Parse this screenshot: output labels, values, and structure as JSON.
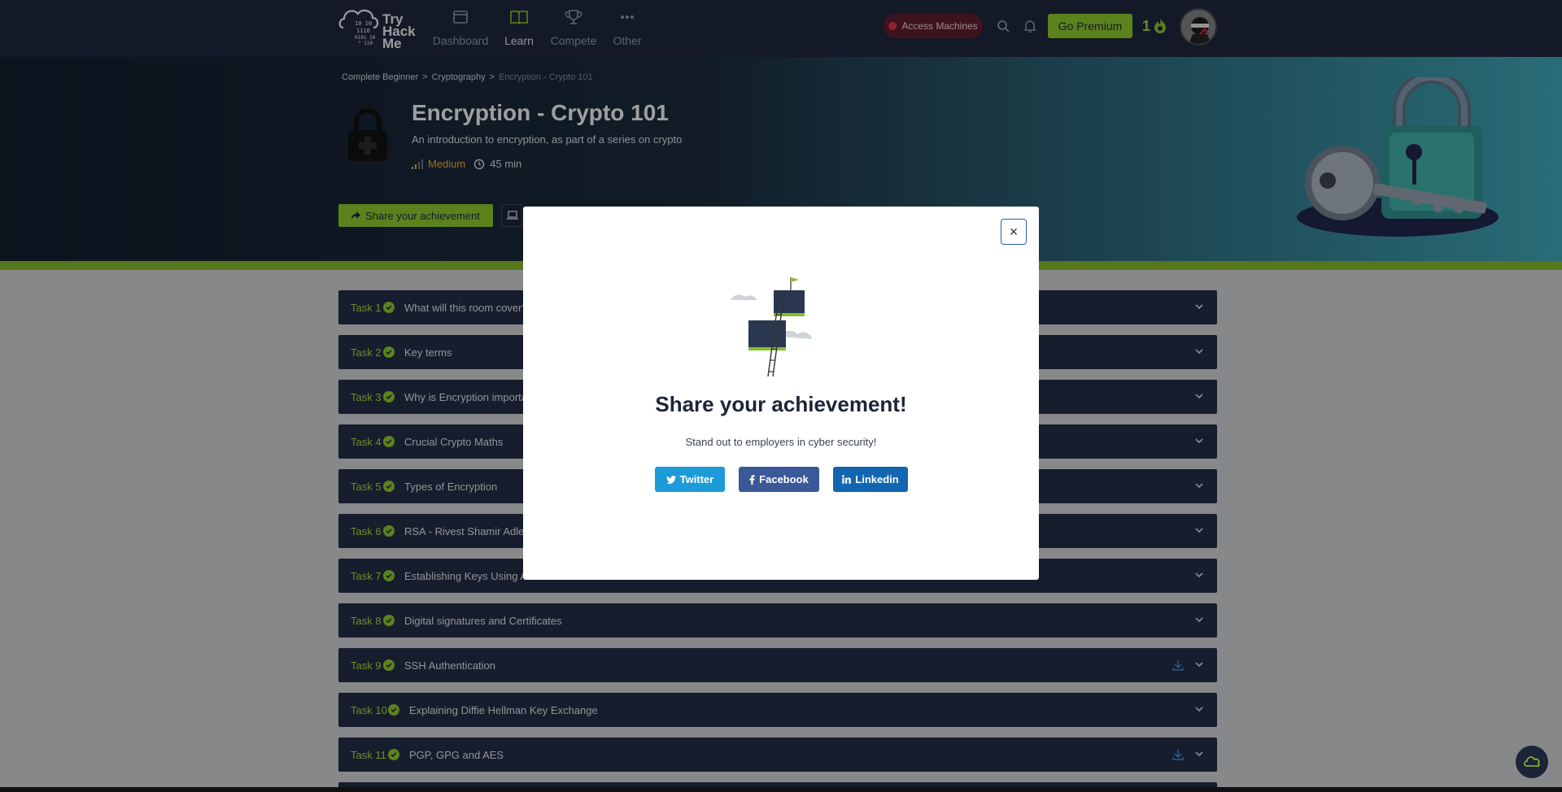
{
  "nav": {
    "brand": "Try Hack Me",
    "items": [
      {
        "label": "Dashboard",
        "icon": "dashboard-icon"
      },
      {
        "label": "Learn",
        "icon": "book-icon",
        "active": true
      },
      {
        "label": "Compete",
        "icon": "trophy-icon"
      },
      {
        "label": "Other",
        "icon": "more-icon"
      }
    ],
    "access_machines": "Access Machines",
    "go_premium": "Go Premium",
    "streak": "1"
  },
  "breadcrumb": {
    "items": [
      "Complete Beginner",
      "Cryptography"
    ],
    "separator": ">",
    "current": "Encryption - Crypto 101"
  },
  "room": {
    "title": "Encryption - Crypto 101",
    "description": "An introduction to encryption, as part of a series on crypto",
    "difficulty": "Medium",
    "duration": "45 min",
    "share_button": "Share your achievement"
  },
  "tasks": [
    {
      "num": "Task 1",
      "title": "What will this room cover?",
      "download": false
    },
    {
      "num": "Task 2",
      "title": "Key terms",
      "download": false
    },
    {
      "num": "Task 3",
      "title": "Why is Encryption importa",
      "download": false
    },
    {
      "num": "Task 4",
      "title": "Crucial Crypto Maths",
      "download": false
    },
    {
      "num": "Task 5",
      "title": "Types of Encryption",
      "download": false
    },
    {
      "num": "Task 6",
      "title": "RSA - Rivest Shamir Adlem",
      "download": false
    },
    {
      "num": "Task 7",
      "title": "Establishing Keys Using As",
      "download": false
    },
    {
      "num": "Task 8",
      "title": "Digital signatures and Certificates",
      "download": false
    },
    {
      "num": "Task 9",
      "title": "SSH Authentication",
      "download": true
    },
    {
      "num": "Task 10",
      "title": "Explaining Diffie Hellman Key Exchange",
      "download": false
    },
    {
      "num": "Task 11",
      "title": "PGP, GPG and AES",
      "download": true
    }
  ],
  "modal": {
    "close": "×",
    "title": "Share your achievement!",
    "subtitle": "Stand out to employers in cyber security!",
    "twitter": "Twitter",
    "facebook": "Facebook",
    "linkedin": "Linkedin"
  },
  "colors": {
    "navy": "#1c2538",
    "green": "#88c02b",
    "task_bg": "#212c42",
    "twitter": "#1d9bd9",
    "facebook": "#3b5998",
    "linkedin": "#1266b0"
  }
}
